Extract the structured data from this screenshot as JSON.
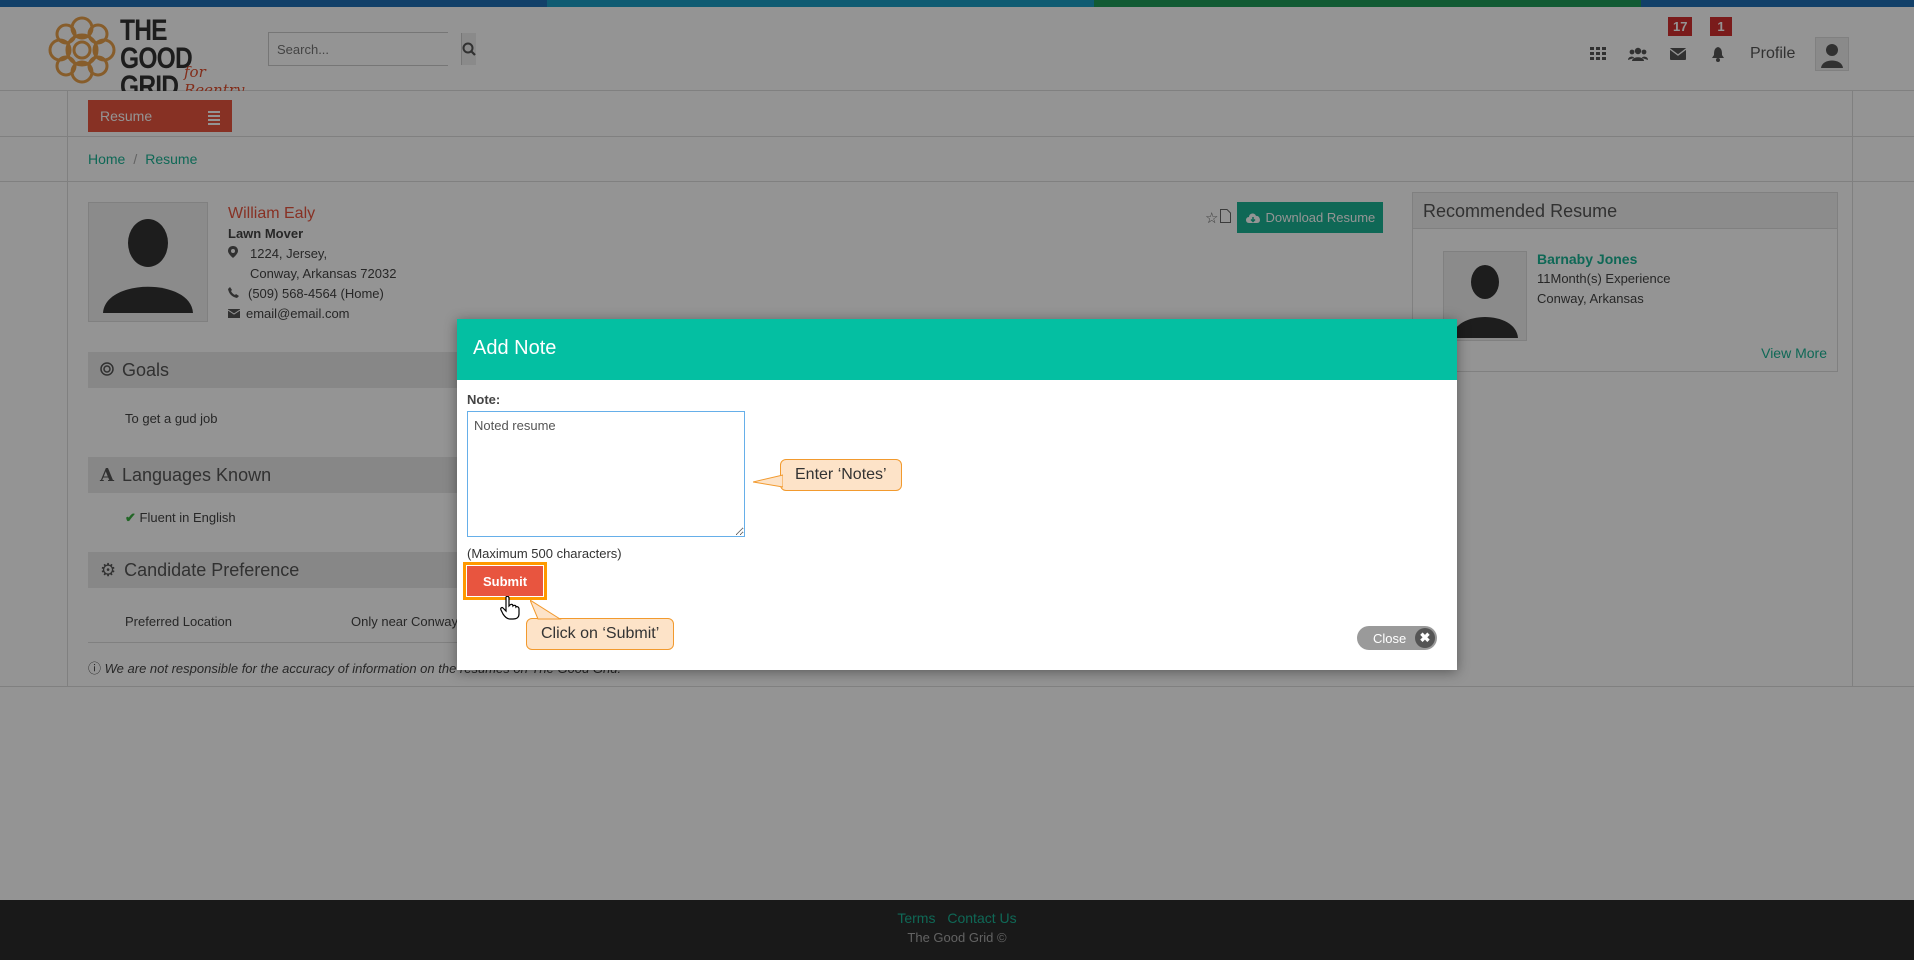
{
  "brand": {
    "logo_line1": "THE GOOD",
    "logo_line2": "GRID",
    "logo_script": "for Reentry",
    "stripe_colors": [
      "#1f6fb5",
      "#1f6fb5",
      "#1a9dc4",
      "#1a9dc4",
      "#1e9b58",
      "#1e9b58",
      "#1f6fb5"
    ]
  },
  "search": {
    "placeholder": "Search..."
  },
  "nav": {
    "messages_badge": "17",
    "notifications_badge": "1",
    "profile_label": "Profile"
  },
  "subnav": {
    "resume_tab": "Resume"
  },
  "breadcrumb": {
    "home": "Home",
    "current": "Resume"
  },
  "candidate": {
    "name": "William Ealy",
    "role": "Lawn Mover",
    "address_line1": "1224, Jersey,",
    "address_line2": "Conway, Arkansas  72032",
    "phone": "(509) 568-4564 (Home)",
    "email": "email@email.com"
  },
  "actions": {
    "download_label": "Download Resume"
  },
  "sections": {
    "goals_title": "Goals",
    "goals_text": "To get a gud job",
    "languages_title": "Languages Known",
    "languages_text": "Fluent in English",
    "preference_title": "Candidate Preference",
    "pref_label": "Preferred Location",
    "pref_value": "Only near Conway",
    "disclaimer": "We are not responsible for the accuracy of information on the resumes on The Good Grid."
  },
  "recommended": {
    "title": "Recommended Resume",
    "name": "Barnaby Jones",
    "experience": "11Month(s) Experience",
    "location": "Conway, Arkansas",
    "view_more": "View More"
  },
  "footer": {
    "terms": "Terms",
    "contact": "Contact Us",
    "copyright": "The Good Grid ©"
  },
  "modal": {
    "title": "Add Note",
    "note_label": "Note:",
    "note_value": "Noted resume",
    "max_chars": "(Maximum 500 characters)",
    "submit_label": "Submit",
    "close_label": "Close"
  },
  "callouts": {
    "notes": "Enter ‘Notes’",
    "submit": "Click on ‘Submit’"
  }
}
